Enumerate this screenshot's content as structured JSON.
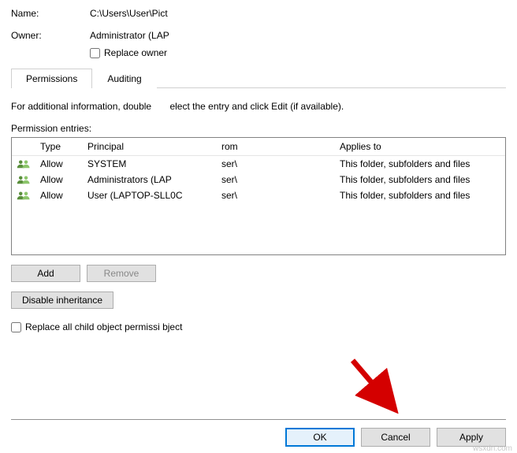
{
  "form": {
    "name_label": "Name:",
    "name_value": "C:\\Users\\User\\Pict",
    "owner_label": "Owner:",
    "owner_value": "Administrator (LAP",
    "replace_owner_label": "Replace owner"
  },
  "tabs": {
    "permissions": "Permissions",
    "auditing": "Auditing"
  },
  "info_text_1": "For additional information, double",
  "info_text_2": "elect the entry and click Edit (if available).",
  "entries_label": "Permission entries:",
  "headers": {
    "type": "Type",
    "principal": "Principal",
    "from": "rom",
    "applies": "Applies to"
  },
  "entries": [
    {
      "type": "Allow",
      "principal": "SYSTEM",
      "from": "ser\\",
      "applies": "This folder, subfolders and files"
    },
    {
      "type": "Allow",
      "principal": "Administrators (LAP",
      "from": "ser\\",
      "applies": "This folder, subfolders and files"
    },
    {
      "type": "Allow",
      "principal": "User (LAPTOP-SLL0C",
      "from": "ser\\",
      "applies": "This folder, subfolders and files"
    }
  ],
  "buttons": {
    "add": "Add",
    "remove": "Remove",
    "disable_inheritance": "Disable inheritance",
    "ok": "OK",
    "cancel": "Cancel",
    "apply": "Apply"
  },
  "bottom_checkbox": "Replace all child object permissi          bject",
  "watermark": "wsxdn.com"
}
